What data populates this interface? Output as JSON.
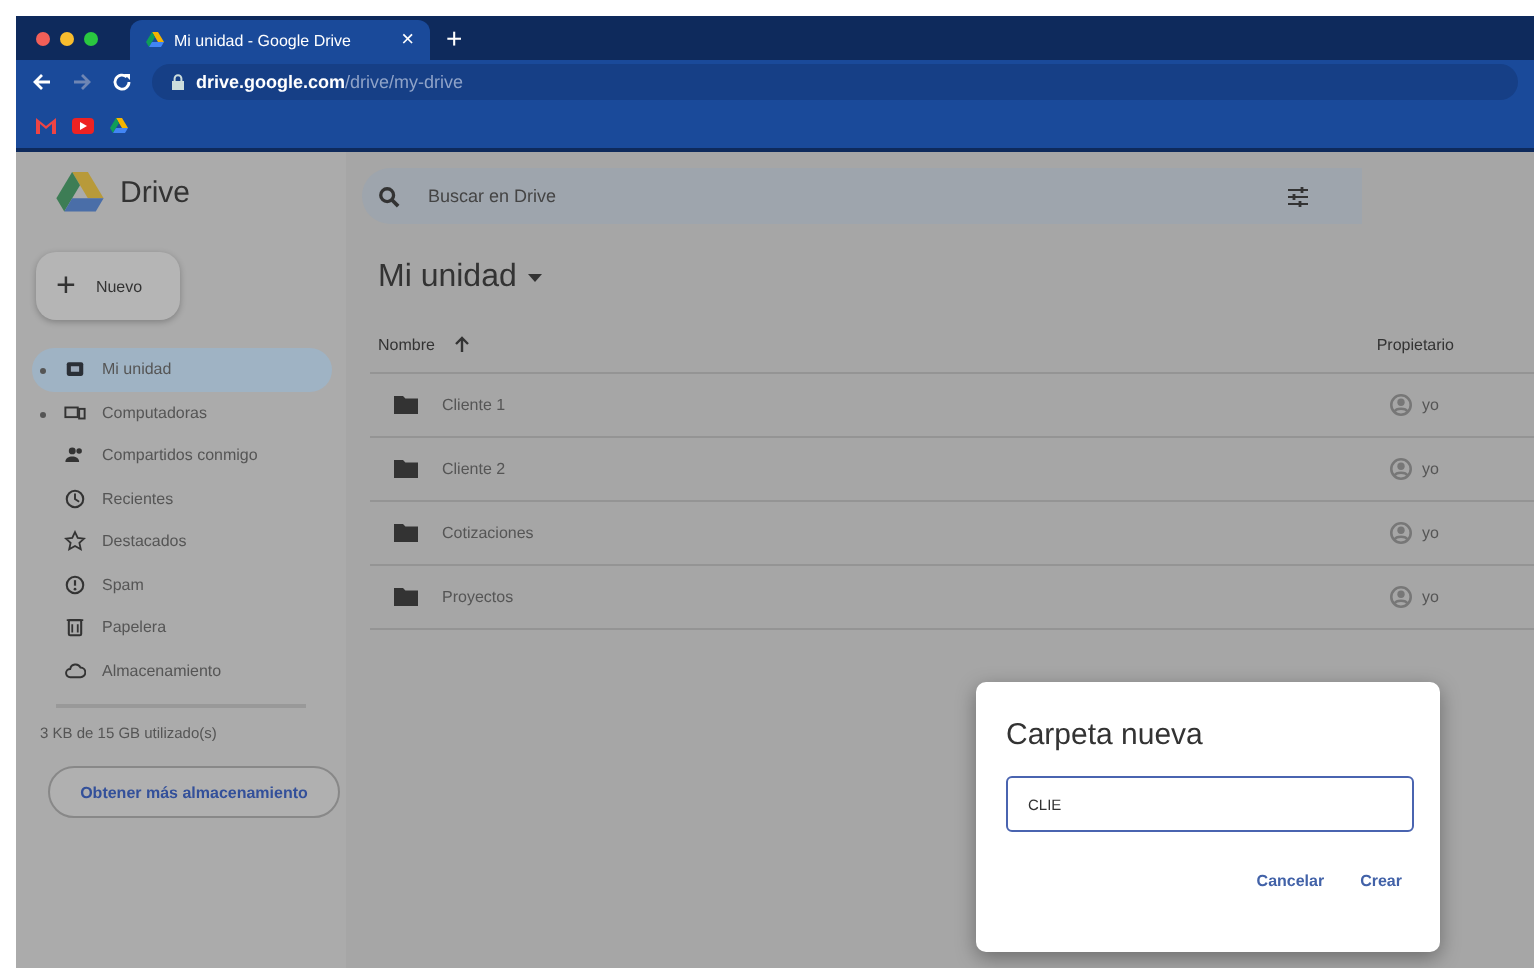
{
  "browser": {
    "tab": {
      "title": "Mi unidad - Google Drive",
      "close": "×"
    },
    "new_tab": "+",
    "url": {
      "host": "drive.google.com",
      "path": "/drive/my-drive"
    }
  },
  "app": {
    "name": "Drive"
  },
  "search": {
    "placeholder": "Buscar en Drive"
  },
  "new_button": {
    "icon": "+",
    "label": "Nuevo"
  },
  "sidebar": {
    "items": [
      {
        "kind": "drive",
        "label": "Mi unidad",
        "selected": true,
        "expandable": true
      },
      {
        "kind": "computers",
        "label": "Computadoras",
        "selected": false,
        "expandable": true
      },
      {
        "kind": "shared",
        "label": "Compartidos conmigo",
        "selected": false,
        "expandable": false
      },
      {
        "kind": "recent",
        "label": "Recientes",
        "selected": false,
        "expandable": false
      },
      {
        "kind": "starred",
        "label": "Destacados",
        "selected": false,
        "expandable": false
      },
      {
        "kind": "spam",
        "label": "Spam",
        "selected": false,
        "expandable": false
      },
      {
        "kind": "trash",
        "label": "Papelera",
        "selected": false,
        "expandable": false
      },
      {
        "kind": "storage",
        "label": "Almacenamiento",
        "selected": false,
        "expandable": false
      }
    ]
  },
  "storage": {
    "usage": "3 KB de 15 GB utilizado(s)",
    "button": "Obtener más almacenamiento"
  },
  "page": {
    "title": "Mi unidad"
  },
  "table": {
    "columns": [
      "Nombre",
      "Propietario"
    ],
    "rows": [
      {
        "name": "Cliente 1",
        "owner": "yo"
      },
      {
        "name": "Cliente 2",
        "owner": "yo"
      },
      {
        "name": "Cotizaciones",
        "owner": "yo"
      },
      {
        "name": "Proyectos",
        "owner": "yo"
      }
    ]
  },
  "dialog": {
    "title": "Carpeta nueva",
    "value": "CLIE",
    "buttons": [
      "Cancelar",
      "Crear"
    ]
  }
}
